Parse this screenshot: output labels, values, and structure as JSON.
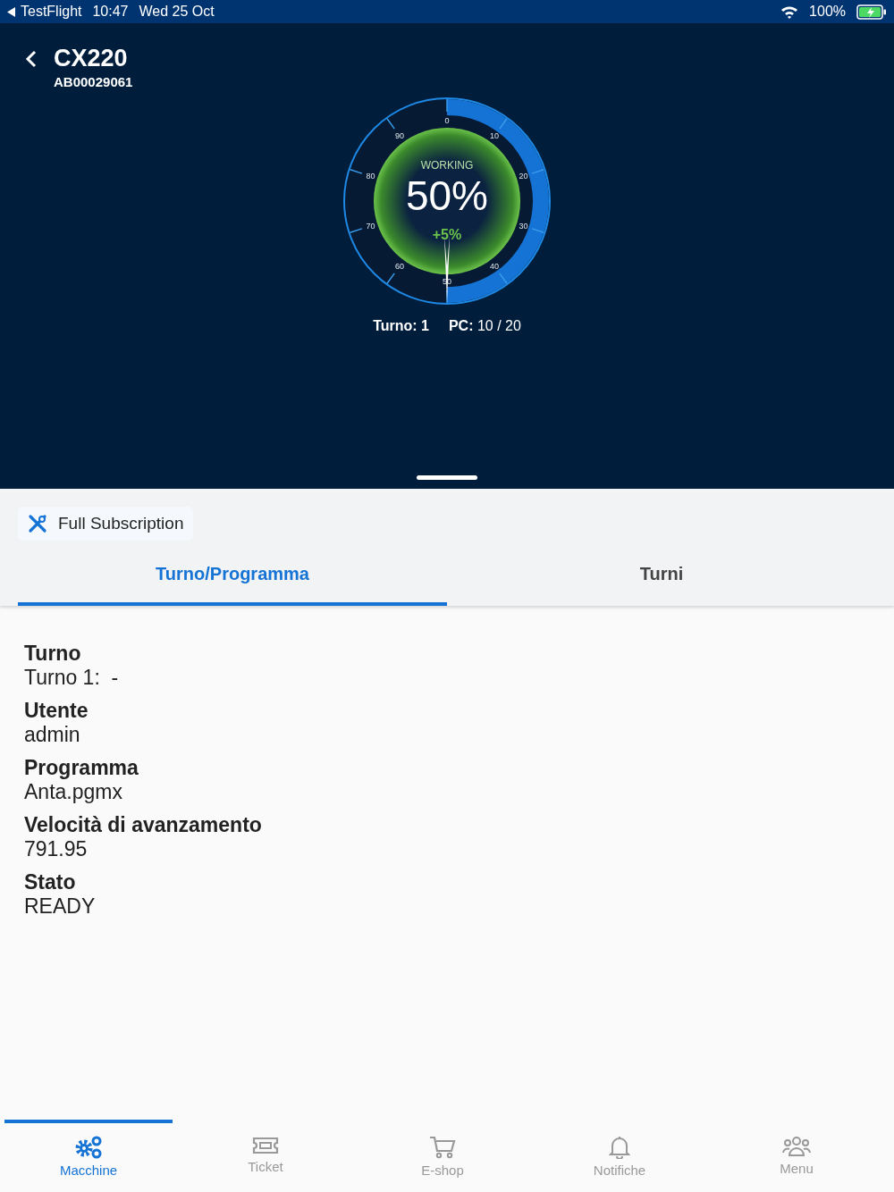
{
  "status_bar": {
    "back_app": "TestFlight",
    "time": "10:47",
    "date": "Wed 25 Oct",
    "battery": "100%"
  },
  "header": {
    "title": "CX220",
    "subtitle": "AB00029061"
  },
  "gauge": {
    "ticks": [
      "0",
      "10",
      "20",
      "30",
      "40",
      "50",
      "60",
      "70",
      "80",
      "90"
    ],
    "level": 0.5,
    "state": "WORKING",
    "value": "50%",
    "delta": "+5%",
    "shift_label": "Turno:",
    "shift_value": "1",
    "pc_label": "PC:",
    "pc_value": "10 / 20"
  },
  "subscription": {
    "label": "Full Subscription"
  },
  "tabs": [
    {
      "label": "Turno/Programma",
      "selected": true
    },
    {
      "label": "Turni",
      "selected": false
    }
  ],
  "fields": [
    {
      "label": "Turno",
      "value": "Turno 1:  -"
    },
    {
      "label": "Utente",
      "value": "admin"
    },
    {
      "label": "Programma",
      "value": "Anta.pgmx"
    },
    {
      "label": "Velocità di avanzamento",
      "value": "791.95"
    },
    {
      "label": "Stato",
      "value": "READY"
    }
  ],
  "nav": [
    {
      "kind": "gears",
      "label": "Macchine",
      "selected": true
    },
    {
      "kind": "ticket",
      "label": "Ticket",
      "selected": false
    },
    {
      "kind": "cart",
      "label": "E-shop",
      "selected": false
    },
    {
      "kind": "bell",
      "label": "Notifiche",
      "selected": false
    },
    {
      "kind": "people",
      "label": "Menu",
      "selected": false
    }
  ]
}
